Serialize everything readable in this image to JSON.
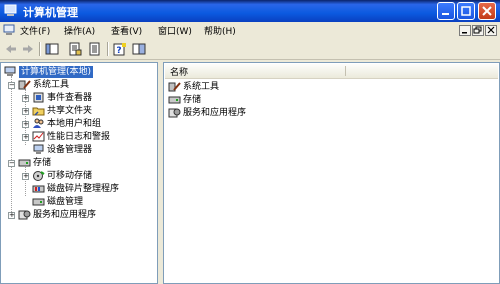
{
  "window": {
    "title": "计算机管理"
  },
  "menu": [
    {
      "label": "文件(F)"
    },
    {
      "label": "操作(A)"
    },
    {
      "label": "查看(V)"
    },
    {
      "label": "窗口(W)"
    },
    {
      "label": "帮助(H)"
    }
  ],
  "tree": {
    "root": "计算机管理(本地)",
    "system_tools": "系统工具",
    "event_viewer": "事件查看器",
    "shared_folders": "共享文件夹",
    "local_users": "本地用户和组",
    "perf_logs": "性能日志和警报",
    "device_manager": "设备管理器",
    "storage": "存储",
    "removable_storage": "可移动存储",
    "defrag": "磁盘碎片整理程序",
    "disk_management": "磁盘管理",
    "services_apps": "服务和应用程序"
  },
  "list": {
    "column_name": "名称",
    "items": [
      "系统工具",
      "存储",
      "服务和应用程序"
    ]
  },
  "colors": {
    "title_bar": "#0b5ae0",
    "selection": "#316ac5",
    "chrome": "#ece9d8"
  }
}
